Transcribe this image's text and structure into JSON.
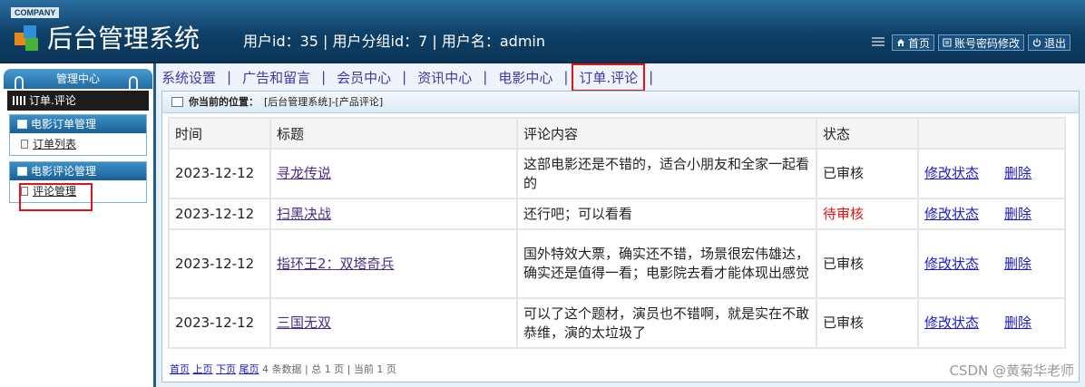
{
  "header": {
    "company": "COMPANY",
    "title": "后台管理系统",
    "user_info": "用户id：35 | 用户分组id：7 | 用户名：admin",
    "links": [
      {
        "label": "首页",
        "icon": "home-icon"
      },
      {
        "label": "账号密码修改",
        "icon": "list-icon"
      },
      {
        "label": "退出",
        "icon": "power-icon"
      }
    ]
  },
  "sidebar": {
    "title": "管理中心",
    "current": "订单.评论",
    "groups": [
      {
        "title": "电影订单管理",
        "items": [
          {
            "label": "订单列表"
          }
        ]
      },
      {
        "title": "电影评论管理",
        "items": [
          {
            "label": "评论管理"
          }
        ]
      }
    ]
  },
  "nav": {
    "items": [
      "系统设置",
      "广告和留言",
      "会员中心",
      "资讯中心",
      "电影中心",
      "订单.评论"
    ],
    "active_index": 5
  },
  "breadcrumb": {
    "label": "你当前的位置：",
    "path": "[后台管理系统]-[产品评论]"
  },
  "table": {
    "headers": [
      "时间",
      "标题",
      "评论内容",
      "状态",
      ""
    ],
    "rows": [
      {
        "time": "2023-12-12",
        "title": "寻龙传说",
        "content": "这部电影还是不错的，适合小朋友和全家一起看的",
        "status": "已审核",
        "edit": "修改状态",
        "del": "删除"
      },
      {
        "time": "2023-12-12",
        "title": "扫黑决战",
        "content": "还行吧；可以看看",
        "status": "待审核",
        "edit": "修改状态",
        "del": "删除"
      },
      {
        "time": "2023-12-12",
        "title": "指环王2：双塔奇兵",
        "content": "国外特效大票，确实还不错，场景很宏伟雄达，确实还是值得一看；电影院去看才能体现出感觉",
        "status": "已审核",
        "edit": "修改状态",
        "del": "删除"
      },
      {
        "time": "2023-12-12",
        "title": "三国无双",
        "content": "可以了这个题材，演员也不错啊，就是实在不敢恭维，演的太垃圾了",
        "status": "已审核",
        "edit": "修改状态",
        "del": "删除"
      }
    ]
  },
  "pager": {
    "first": "首页",
    "prev": "上页",
    "next": "下页",
    "last": "尾页",
    "info": "4 条数据 | 总 1 页 | 当前 1 页"
  },
  "watermark": "CSDN @黄菊华老师",
  "colors": {
    "pending": "#e01010",
    "highlight_box": "#e0151b"
  }
}
